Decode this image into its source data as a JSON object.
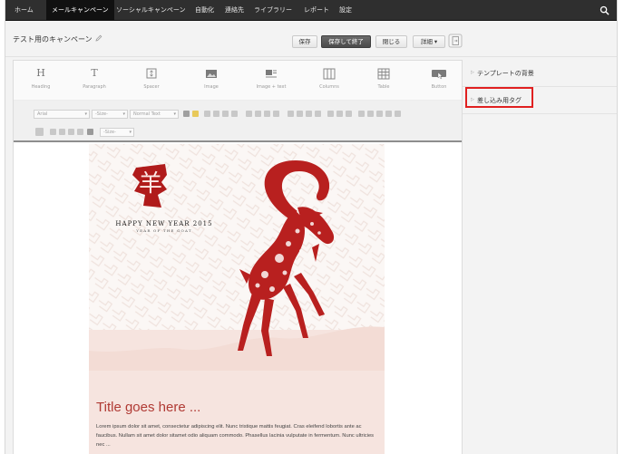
{
  "nav": {
    "items": [
      "ホーム",
      "メールキャンペーン",
      "ソーシャルキャンペーン",
      "自動化",
      "連絡先",
      "ライブラリー",
      "レポート",
      "設定"
    ],
    "active_index": 1
  },
  "campaign": {
    "title": "テスト用のキャンペーン"
  },
  "actions": {
    "save": "保存",
    "save_close": "保存して終了",
    "close": "閉じる",
    "details": "詳細 ▾"
  },
  "blocks": [
    {
      "label": "Heading",
      "icon": "H"
    },
    {
      "label": "Paragraph",
      "icon": "T"
    },
    {
      "label": "Spacer",
      "icon": "spacer-icon"
    },
    {
      "label": "Image",
      "icon": "image-icon"
    },
    {
      "label": "Image + text",
      "icon": "image-text-icon"
    },
    {
      "label": "Columns",
      "icon": "columns-icon"
    },
    {
      "label": "Table",
      "icon": "table-icon"
    },
    {
      "label": "Button",
      "icon": "button-icon"
    }
  ],
  "format": {
    "font": "Arial",
    "size": "-Size-",
    "style": "Normal Text",
    "size2": "-Size-"
  },
  "email": {
    "greeting": "HAPPY NEW YEAR 2015",
    "subtitle": "YEAR OF THE GOAT",
    "kanji": "羊",
    "headline": "Title goes here ...",
    "body": "Lorem ipsum dolor sit amet, consectetur adipiscing elit. Nunc tristique mattis feugiat. Cras eleifend lobortis ante ac faucibus. Nullam sit amet dolor sitamet odio aliquam commodo. Phasellus lacinia vulputate in fermentum. Nunc ultricies nec ...",
    "accent_color": "#b03a34"
  },
  "panel": {
    "items": [
      "テンプレートの背景",
      "差し込み用タグ"
    ]
  }
}
